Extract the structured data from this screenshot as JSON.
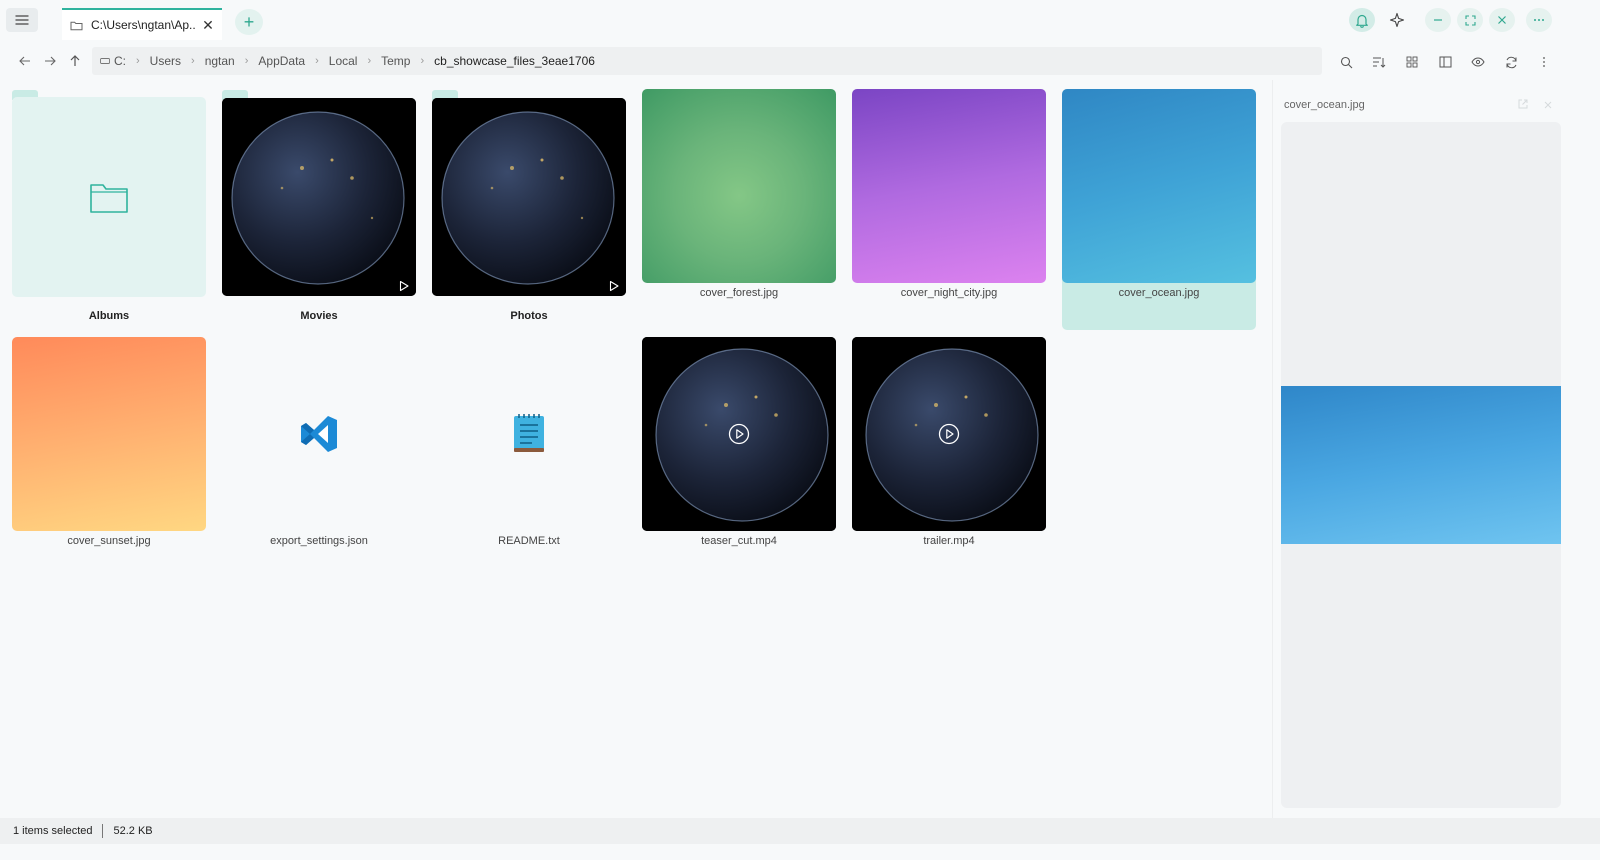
{
  "tab": {
    "title": "C:\\Users\\ngtan\\Ap...",
    "close_label": "✕",
    "new_tab_label": "+"
  },
  "breadcrumb": [
    {
      "label": "C:"
    },
    {
      "label": "Users"
    },
    {
      "label": "ngtan"
    },
    {
      "label": "AppData"
    },
    {
      "label": "Local"
    },
    {
      "label": "Temp"
    },
    {
      "label": "cb_showcase_files_3eae1706"
    }
  ],
  "items": [
    {
      "name": "Albums",
      "kind": "folder"
    },
    {
      "name": "Movies",
      "kind": "folder-video"
    },
    {
      "name": "Photos",
      "kind": "folder-video"
    },
    {
      "name": "cover_forest.jpg",
      "kind": "image",
      "colors": [
        "#3f9a64",
        "#7fc383"
      ]
    },
    {
      "name": "cover_night_city.jpg",
      "kind": "image",
      "colors": [
        "#7b45c4",
        "#dc82ef"
      ]
    },
    {
      "name": "cover_ocean.jpg",
      "kind": "image",
      "colors": [
        "#2f87c4",
        "#55c0e0"
      ],
      "selected": true
    },
    {
      "name": "cover_sunset.jpg",
      "kind": "image",
      "colors": [
        "#ff8a5a",
        "#ffd782"
      ]
    },
    {
      "name": "export_settings.json",
      "kind": "vscode-file"
    },
    {
      "name": "README.txt",
      "kind": "notepad-file"
    },
    {
      "name": "teaser_cut.mp4",
      "kind": "video"
    },
    {
      "name": "trailer.mp4",
      "kind": "video"
    }
  ],
  "preview": {
    "title": "cover_ocean.jpg"
  },
  "status": {
    "selected": "1 items selected",
    "size": "52.2 KB"
  },
  "colors": {
    "accent": "#2fb39e",
    "accent_light": "#c9ebe5"
  }
}
